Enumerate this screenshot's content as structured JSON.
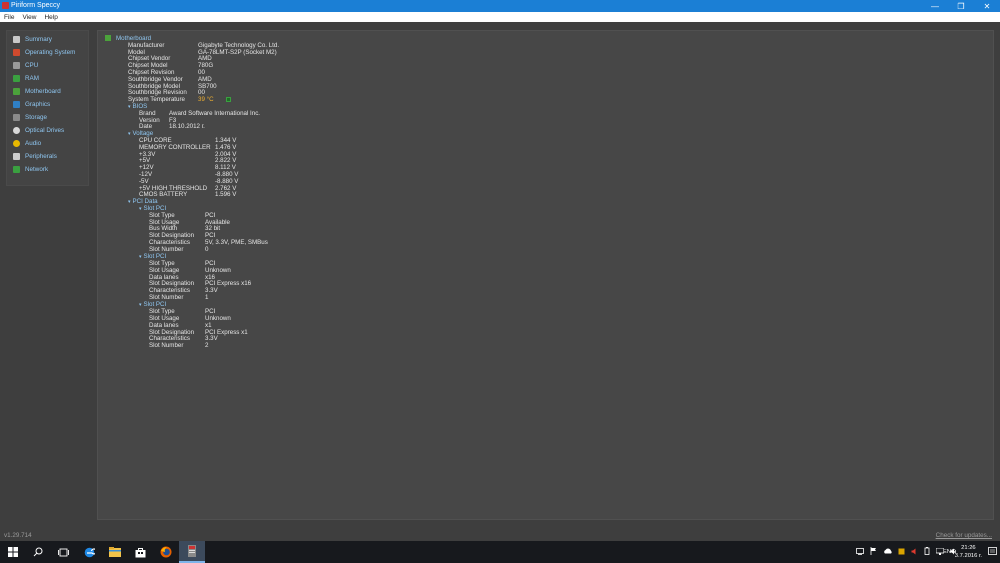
{
  "window": {
    "title": "Piriform Speccy",
    "minimize": "—",
    "maximize": "❐",
    "close": "✕"
  },
  "menu": [
    "File",
    "View",
    "Help"
  ],
  "sidebar": {
    "items": [
      {
        "label": "Summary",
        "icon": "summary-icon",
        "color": "#c9c9c9"
      },
      {
        "label": "Operating System",
        "icon": "windows-icon",
        "color": "#d04a2e"
      },
      {
        "label": "CPU",
        "icon": "cpu-icon",
        "color": "#9a9a9a"
      },
      {
        "label": "RAM",
        "icon": "ram-icon",
        "color": "#3aa040"
      },
      {
        "label": "Motherboard",
        "icon": "motherboard-icon",
        "color": "#4ba23b"
      },
      {
        "label": "Graphics",
        "icon": "graphics-icon",
        "color": "#2f7fc4"
      },
      {
        "label": "Storage",
        "icon": "storage-icon",
        "color": "#8a8a8a"
      },
      {
        "label": "Optical Drives",
        "icon": "disc-icon",
        "color": "#d8d8d8"
      },
      {
        "label": "Audio",
        "icon": "audio-icon",
        "color": "#e8b800"
      },
      {
        "label": "Peripherals",
        "icon": "mouse-icon",
        "color": "#cccccc"
      },
      {
        "label": "Network",
        "icon": "network-icon",
        "color": "#3aa040"
      }
    ]
  },
  "content": {
    "heading": "Motherboard",
    "main_rows": [
      {
        "k": "Manufacturer",
        "v": "Gigabyte Technology Co. Ltd."
      },
      {
        "k": "Model",
        "v": "GA-78LMT-S2P (Socket M2)"
      },
      {
        "k": "Chipset Vendor",
        "v": "AMD"
      },
      {
        "k": "Chipset Model",
        "v": "780G"
      },
      {
        "k": "Chipset Revision",
        "v": "00"
      },
      {
        "k": "Southbridge Vendor",
        "v": "AMD"
      },
      {
        "k": "Southbridge Model",
        "v": "SB700"
      },
      {
        "k": "Southbridge Revision",
        "v": "00"
      },
      {
        "k": "System Temperature",
        "v": "39 °C"
      }
    ],
    "temp_color": "#f0b030",
    "bios": {
      "label": "BIOS",
      "rows": [
        {
          "k": "Brand",
          "v": "Award Software International Inc."
        },
        {
          "k": "Version",
          "v": "F3"
        },
        {
          "k": "Date",
          "v": "18.10.2012 г."
        }
      ]
    },
    "voltage": {
      "label": "Voltage",
      "rows": [
        {
          "k": "CPU CORE",
          "v": "1.344 V"
        },
        {
          "k": "MEMORY CONTROLLER",
          "v": "1.476 V"
        },
        {
          "k": "+3.3V",
          "v": "2.004 V"
        },
        {
          "k": "+5V",
          "v": "2.822 V"
        },
        {
          "k": "+12V",
          "v": "8.112 V"
        },
        {
          "k": "-12V",
          "v": "-8.880 V"
        },
        {
          "k": "-5V",
          "v": "-8.880 V"
        },
        {
          "k": "+5V HIGH THRESHOLD",
          "v": "2.762 V"
        },
        {
          "k": "CMOS BATTERY",
          "v": "1.596 V"
        }
      ]
    },
    "pci": {
      "label": "PCI Data",
      "slots": [
        {
          "label": "Slot PCI",
          "rows": [
            {
              "k": "Slot Type",
              "v": "PCI"
            },
            {
              "k": "Slot Usage",
              "v": "Available"
            },
            {
              "k": "Bus Width",
              "v": "32 bit"
            },
            {
              "k": "Slot Designation",
              "v": "PCI"
            },
            {
              "k": "Characteristics",
              "v": "5V, 3.3V, PME, SMBus"
            },
            {
              "k": "Slot Number",
              "v": "0"
            }
          ]
        },
        {
          "label": "Slot PCI",
          "rows": [
            {
              "k": "Slot Type",
              "v": "PCI"
            },
            {
              "k": "Slot Usage",
              "v": "Unknown"
            },
            {
              "k": "Data lanes",
              "v": "x16"
            },
            {
              "k": "Slot Designation",
              "v": "PCI Express x16"
            },
            {
              "k": "Characteristics",
              "v": "3.3V"
            },
            {
              "k": "Slot Number",
              "v": "1"
            }
          ]
        },
        {
          "label": "Slot PCI",
          "rows": [
            {
              "k": "Slot Type",
              "v": "PCI"
            },
            {
              "k": "Slot Usage",
              "v": "Unknown"
            },
            {
              "k": "Data lanes",
              "v": "x1"
            },
            {
              "k": "Slot Designation",
              "v": "PCI Express x1"
            },
            {
              "k": "Characteristics",
              "v": "3.3V"
            },
            {
              "k": "Slot Number",
              "v": "2"
            }
          ]
        }
      ]
    }
  },
  "status": {
    "version": "v1.29.714",
    "updates": "Check for updates..."
  },
  "taskbar": {
    "apps": [
      "start-icon",
      "search-icon",
      "task-view-icon",
      "edge-icon",
      "file-explorer-icon",
      "store-icon",
      "firefox-icon",
      "speccy-icon"
    ],
    "lang": "ENG",
    "time": "21:26",
    "date": "3.7.2016 г."
  }
}
